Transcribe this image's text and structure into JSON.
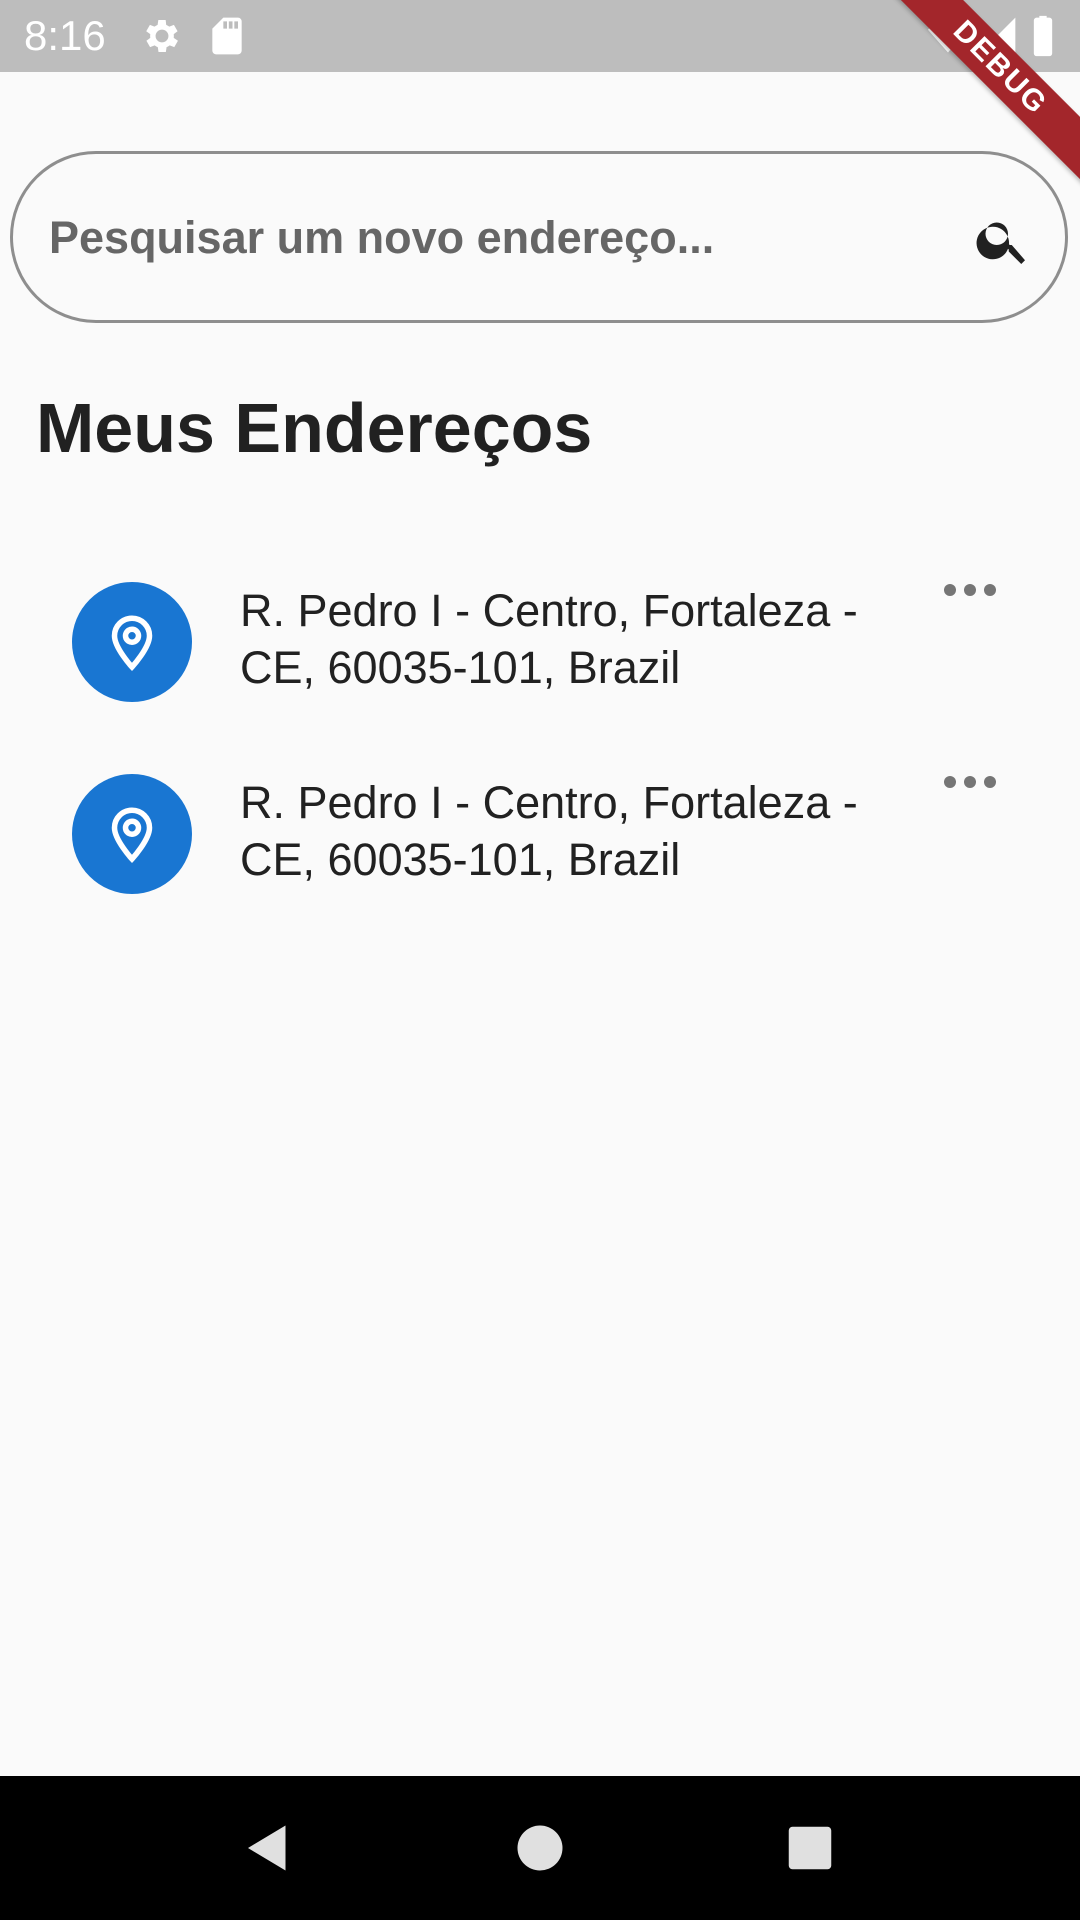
{
  "status_bar": {
    "time": "8:16",
    "icons": [
      "settings-icon",
      "sd-card-icon",
      "wifi-icon",
      "signal-icon",
      "battery-icon"
    ]
  },
  "debug_banner": {
    "label": "DEBUG",
    "color": "#A3262B"
  },
  "search": {
    "placeholder": "Pesquisar um novo endereço...",
    "value": "",
    "icon": "search-icon"
  },
  "section": {
    "title": "Meus Endereços"
  },
  "addresses": [
    {
      "text": "R. Pedro I - Centro, Fortaleza - CE, 60035-101, Brazil",
      "icon": "location-pin-icon",
      "menu_icon": "more-horizontal-icon"
    },
    {
      "text": "R. Pedro I - Centro, Fortaleza - CE, 60035-101, Brazil",
      "icon": "location-pin-icon",
      "menu_icon": "more-horizontal-icon"
    }
  ],
  "navigation": {
    "buttons": [
      "back-icon",
      "home-icon",
      "recents-icon"
    ]
  },
  "colors": {
    "accent": "#1976D2",
    "status_bar": "#BDBDBD",
    "background": "#FAFAFA",
    "nav_bar": "#000000"
  }
}
